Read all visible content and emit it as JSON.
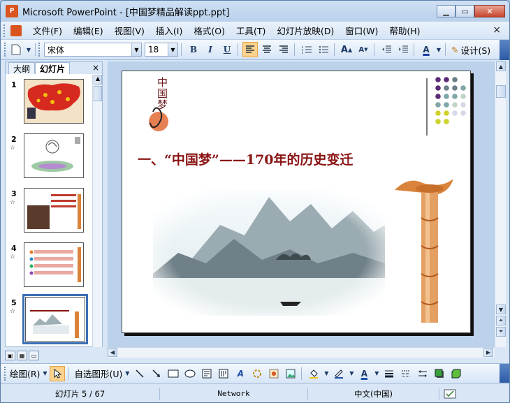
{
  "window": {
    "title": "Microsoft PowerPoint - [中国梦精品解读ppt.ppt]",
    "buttons": {
      "minimize": "▁",
      "restore": "▭",
      "close": "✕"
    }
  },
  "menubar": {
    "items": [
      "文件(F)",
      "编辑(E)",
      "视图(V)",
      "插入(I)",
      "格式(O)",
      "工具(T)",
      "幻灯片放映(D)",
      "窗口(W)",
      "帮助(H)"
    ],
    "close": "×"
  },
  "toolbar": {
    "font_name": "宋体",
    "font_size": "18",
    "bold": "B",
    "italic": "I",
    "underline": "U",
    "font_color": "A",
    "design": "设计(S)"
  },
  "left_panel": {
    "tabs": [
      "大纲",
      "幻灯片"
    ],
    "close": "×",
    "slides": [
      {
        "num": "1",
        "star": ""
      },
      {
        "num": "2",
        "star": "☆"
      },
      {
        "num": "3",
        "star": "☆"
      },
      {
        "num": "4",
        "star": "☆"
      },
      {
        "num": "5",
        "star": "☆"
      }
    ]
  },
  "slide": {
    "logo_text": "中国梦",
    "title": "一、“中国梦”——170年的历史变迁"
  },
  "drawbar": {
    "draw": "绘图(R)",
    "autoshapes": "自选图形(U)"
  },
  "status": {
    "slide_info": "幻灯片 5 / 67",
    "template": "Network",
    "language": "中文(中国)"
  },
  "colors": {
    "title_red": "#8a1414",
    "accent_orange": "#d9541e",
    "selected_blue": "#3a6fb5"
  }
}
